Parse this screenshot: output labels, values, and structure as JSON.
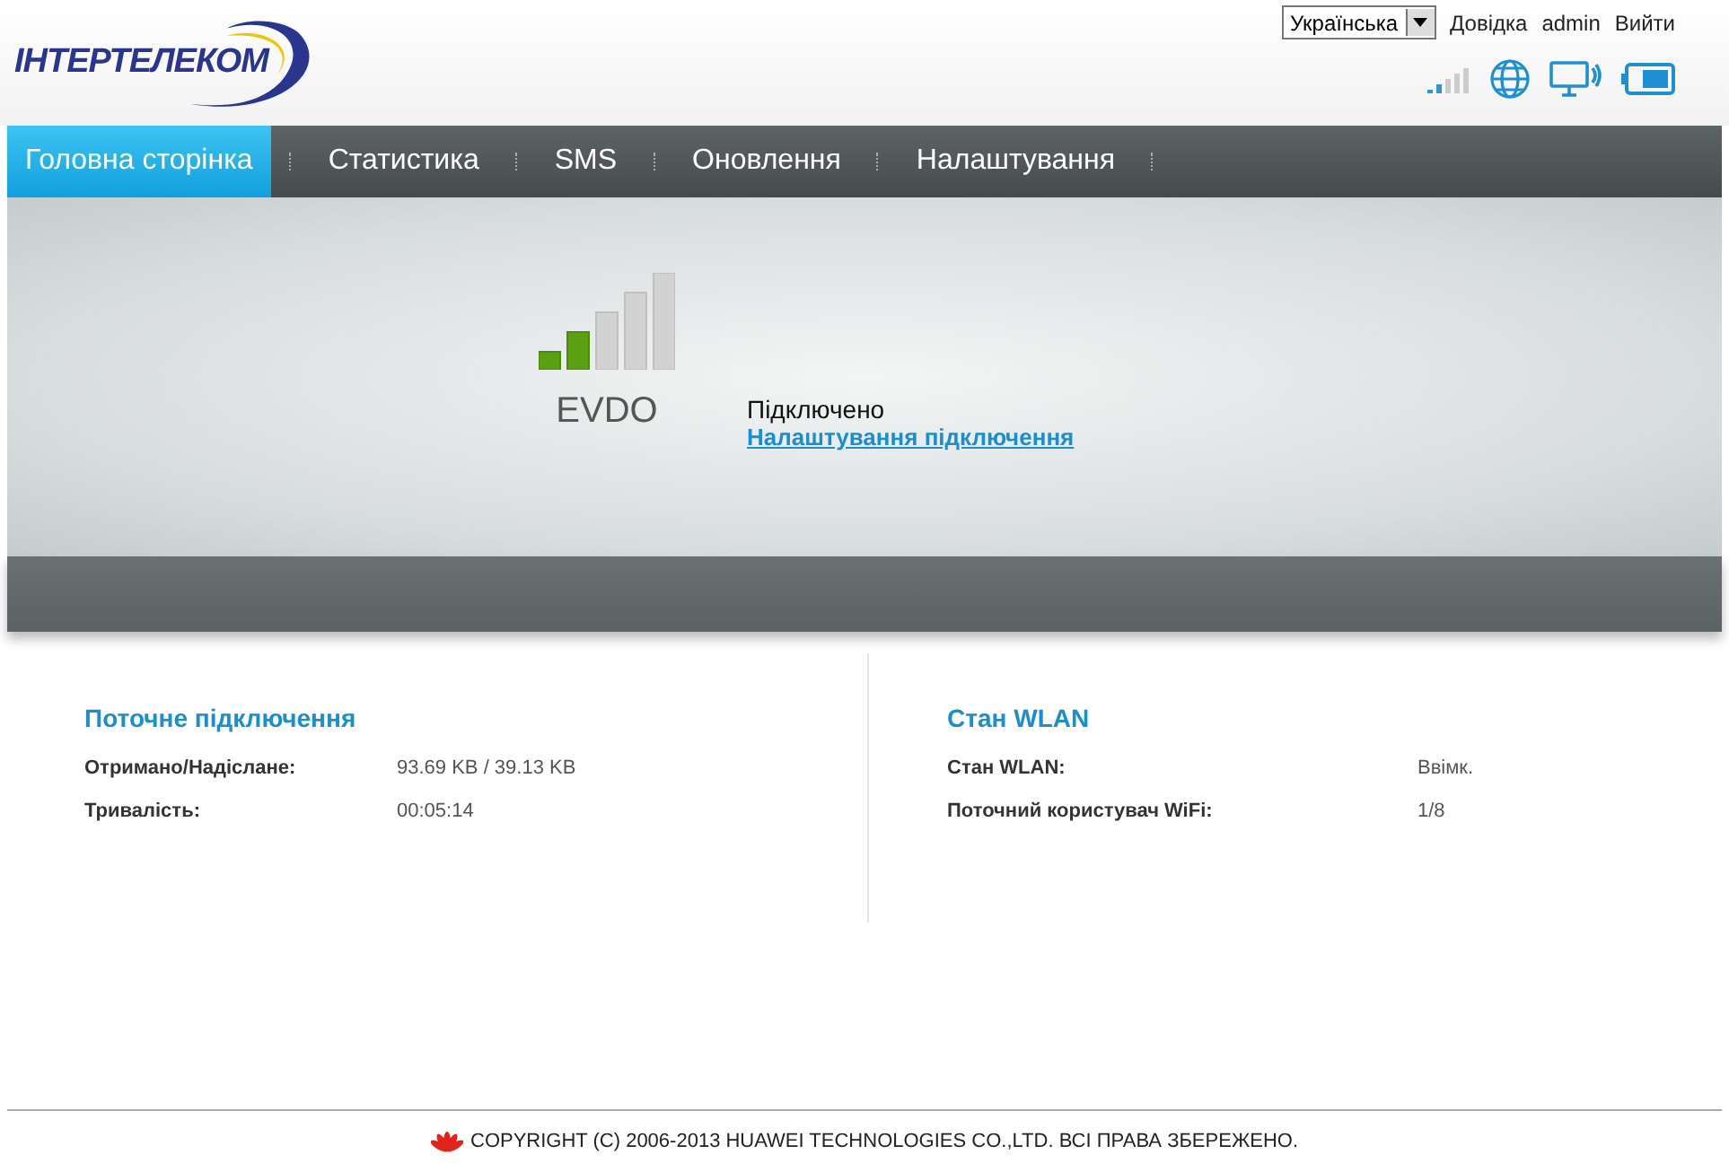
{
  "header": {
    "logo": "ІНТЕРТЕЛЕКОМ",
    "language": "Українська",
    "links": [
      "Довідка",
      "admin",
      "Вийти"
    ]
  },
  "nav": [
    {
      "label": "Головна сторінка",
      "selected": true
    },
    {
      "label": "Статистика",
      "selected": false
    },
    {
      "label": "SMS",
      "selected": false
    },
    {
      "label": "Оновлення",
      "selected": false
    },
    {
      "label": "Налаштування",
      "selected": false
    }
  ],
  "status": {
    "network": "EVDO",
    "state": "Підключено",
    "settings_link": "Налаштування підключення"
  },
  "panels": [
    {
      "title": "Поточне підключення",
      "rows": [
        {
          "label": "Отримано/Надіслане:",
          "value": "93.69 KB / 39.13 KB"
        },
        {
          "label": "Тривалість:",
          "value": "00:05:14"
        }
      ]
    },
    {
      "title": "Стан WLAN",
      "rows": [
        {
          "label": "Стан WLAN:",
          "value": "Ввімк."
        },
        {
          "label": "Поточний користувач WiFi:",
          "value": "1/8"
        }
      ]
    }
  ],
  "footer": "COPYRIGHT (C) 2006-2013 HUAWEI TECHNOLOGIES CO.,LTD. ВСІ ПРАВА ЗБЕРЕЖЕНО."
}
